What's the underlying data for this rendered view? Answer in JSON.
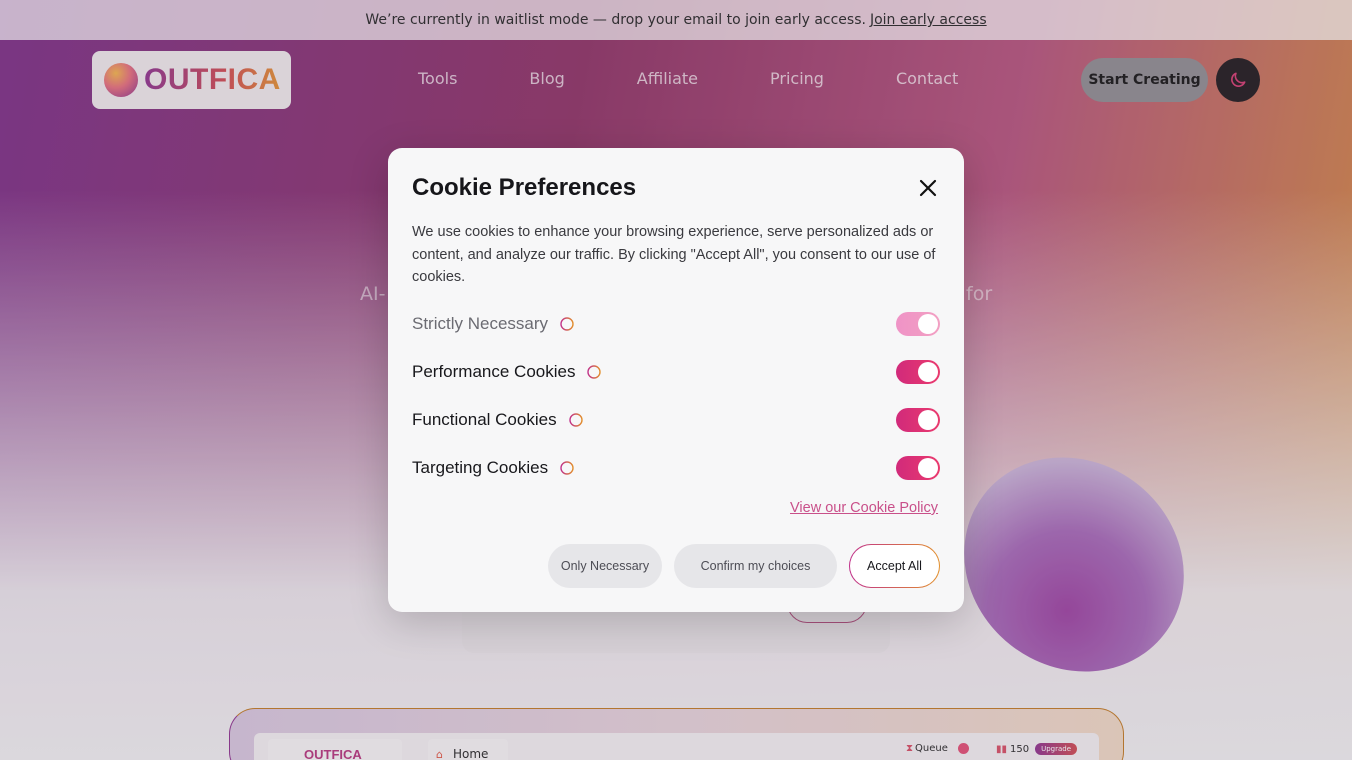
{
  "announcement": {
    "text": "We’re currently in waitlist mode — drop your email to join early access.",
    "link": "Join early access"
  },
  "brand": {
    "name": "OUTFICA"
  },
  "nav": {
    "links": [
      "Tools",
      "Blog",
      "Affiliate",
      "Pricing",
      "Contact"
    ],
    "cta": "Start Creating",
    "theme_icon": "moon-icon"
  },
  "hero": {
    "subtitle_left": "AI-",
    "subtitle_right": "for"
  },
  "app_preview": {
    "brand": "OUTFICA",
    "home": "Home",
    "queue": "Queue",
    "credits": "150",
    "upgrade": "Upgrade"
  },
  "cookie_modal": {
    "title": "Cookie Preferences",
    "description": "We use cookies to enhance your browsing experience, serve personalized ads or content, and analyze our traffic. By clicking \"Accept All\", you consent to our use of cookies.",
    "preferences": [
      {
        "label": "Strictly Necessary",
        "enabled": true,
        "locked": true
      },
      {
        "label": "Performance Cookies",
        "enabled": true,
        "locked": false
      },
      {
        "label": "Functional Cookies",
        "enabled": true,
        "locked": false
      },
      {
        "label": "Targeting Cookies",
        "enabled": true,
        "locked": false
      }
    ],
    "policy_link": "View our Cookie Policy",
    "buttons": {
      "only_necessary": "Only Necessary",
      "confirm": "Confirm my choices",
      "accept_all": "Accept All"
    }
  },
  "colors": {
    "accent": "#d12a7b",
    "accent_warm": "#e2902d",
    "brand_purple": "#8b2e8d"
  }
}
